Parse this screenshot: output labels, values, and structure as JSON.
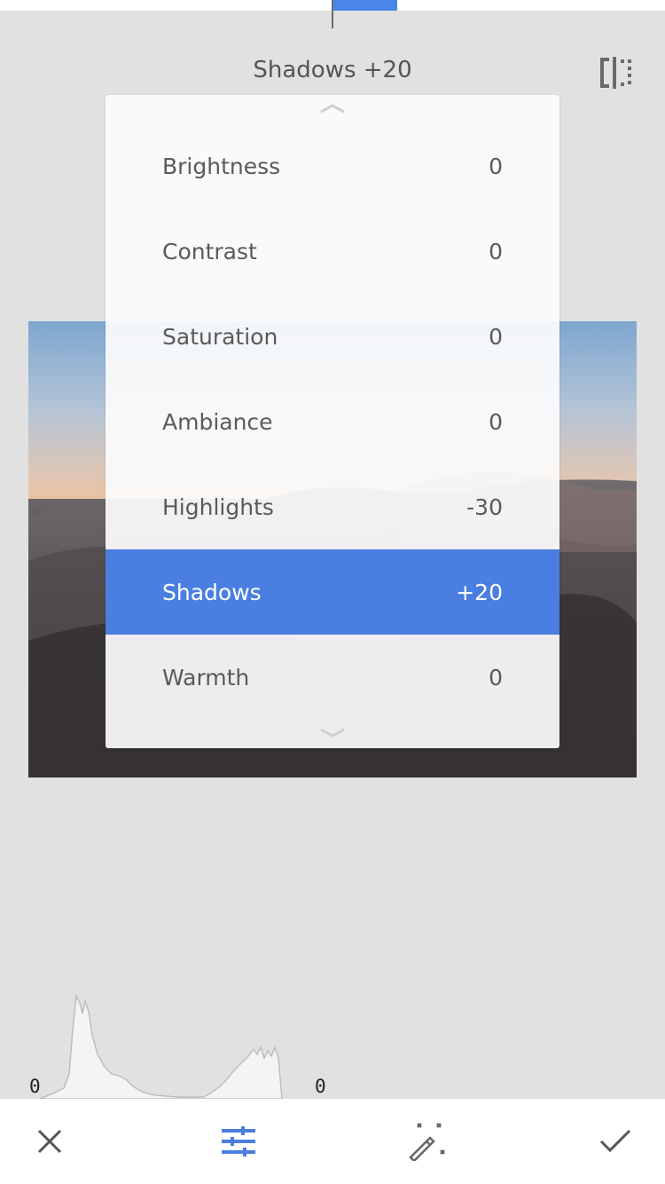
{
  "header": {
    "title": "Shadows +20",
    "compare_icon": "compare-split-icon"
  },
  "slider": {
    "value": 20,
    "accent": "#4a86e8"
  },
  "menu": {
    "items": [
      {
        "label": "Brightness",
        "value": "0"
      },
      {
        "label": "Contrast",
        "value": "0"
      },
      {
        "label": "Saturation",
        "value": "0"
      },
      {
        "label": "Ambiance",
        "value": "0"
      },
      {
        "label": "Highlights",
        "value": "-30"
      },
      {
        "label": "Shadows",
        "value": "+20",
        "selected": true
      },
      {
        "label": "Warmth",
        "value": "0"
      }
    ],
    "selected_color": "#4a7ee0"
  },
  "histogram": {
    "left_label": "0",
    "right_label": "0"
  },
  "bottom_bar": {
    "cancel_icon": "close-icon",
    "tune_icon": "tune-sliders-icon",
    "auto_icon": "magic-wand-icon",
    "apply_icon": "checkmark-icon",
    "active_color": "#4a7ee0"
  }
}
